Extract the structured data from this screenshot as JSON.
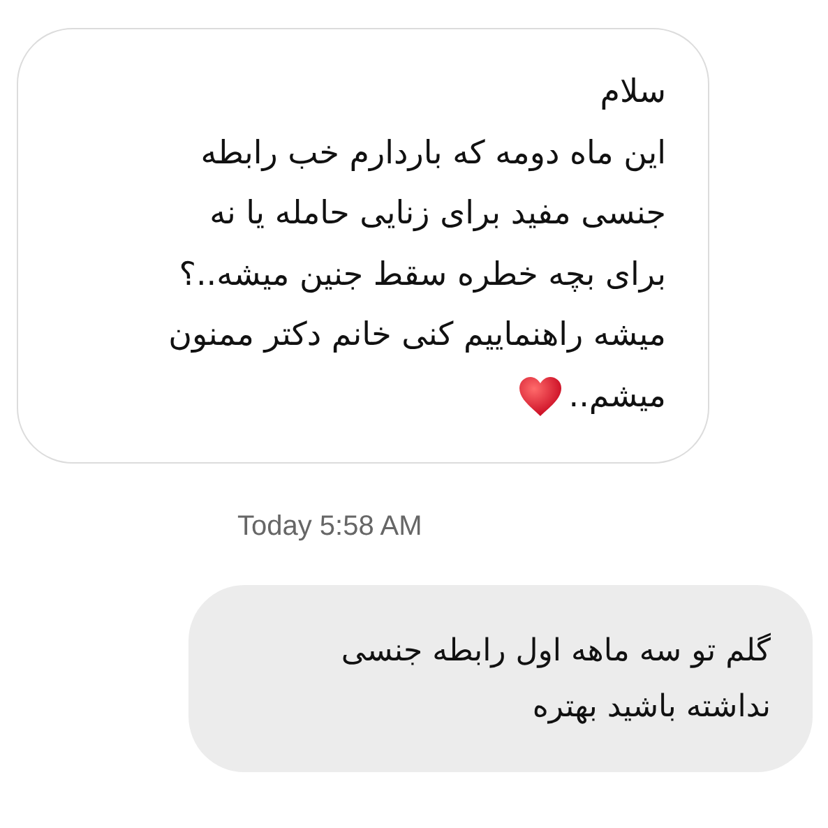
{
  "messages": [
    {
      "kind": "received",
      "lines": [
        "سلام",
        "این ماه دومه که باردارم خب رابطه",
        "جنسی مفید برای زنایی حامله یا نه",
        "برای بچه خطره سقط جنین میشه..؟",
        "میشه راهنماییم کنی خانم دکتر ممنون",
        "میشم.."
      ]
    },
    {
      "kind": "timestamp",
      "text": "Today 5:58 AM"
    },
    {
      "kind": "sent",
      "lines": [
        "گلم تو سه ماهه اول رابطه جنسی",
        "نداشته باشید بهتره"
      ]
    }
  ]
}
